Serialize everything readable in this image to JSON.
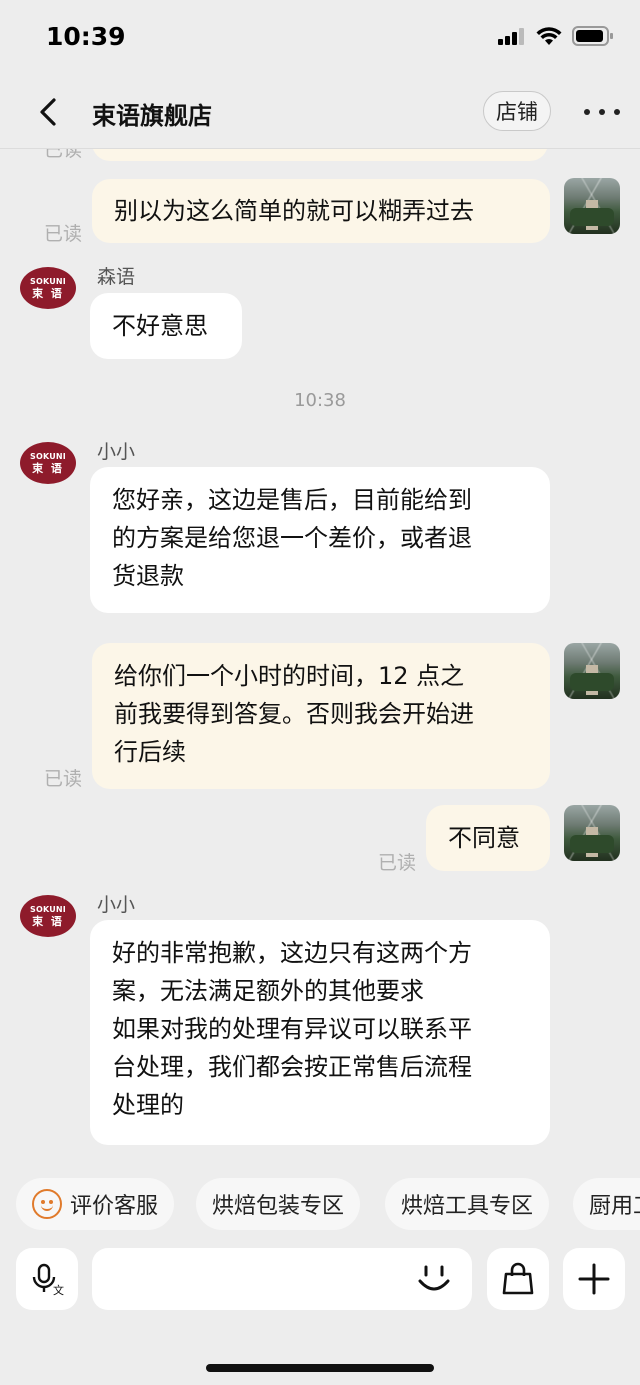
{
  "status_bar": {
    "time": "10:39"
  },
  "header": {
    "title": "束语旗舰店",
    "store_button": "店铺"
  },
  "avatar_logo": {
    "en": "SOKUNI",
    "cn": "束 语"
  },
  "messages": [
    {
      "side": "me",
      "text": "别以为这么简单的就可以糊弄过去",
      "read": "已读"
    },
    {
      "side": "them",
      "sender": "森语",
      "text": "不好意思"
    },
    {
      "type": "time",
      "text": "10:38"
    },
    {
      "side": "them",
      "sender": "小小",
      "lines": [
        "您好亲，这边是售后，目前能给到",
        "的方案是给您退一个差价，或者退",
        "货退款"
      ]
    },
    {
      "side": "me",
      "lines": [
        "给你们一个小时的时间，12 点之",
        "前我要得到答复。否则我会开始进",
        "行后续"
      ],
      "read": "已读"
    },
    {
      "side": "me",
      "text": "不同意",
      "read": "已读"
    },
    {
      "side": "them",
      "sender": "小小",
      "lines": [
        "好的非常抱歉，这边只有这两个方",
        "案，无法满足额外的其他要求",
        "如果对我的处理有异议可以联系平",
        "台处理，我们都会按正常售后流程",
        "处理的"
      ]
    }
  ],
  "partial_read_top": "已读",
  "quick_chips": [
    "评价客服",
    "烘焙包装专区",
    "烘焙工具专区",
    "厨用工"
  ],
  "input": {
    "placeholder": ""
  },
  "colors": {
    "my_bubble": "#fcf6e8",
    "their_bubble": "#ffffff",
    "brand": "#8e1b2b",
    "background": "#ededed"
  }
}
